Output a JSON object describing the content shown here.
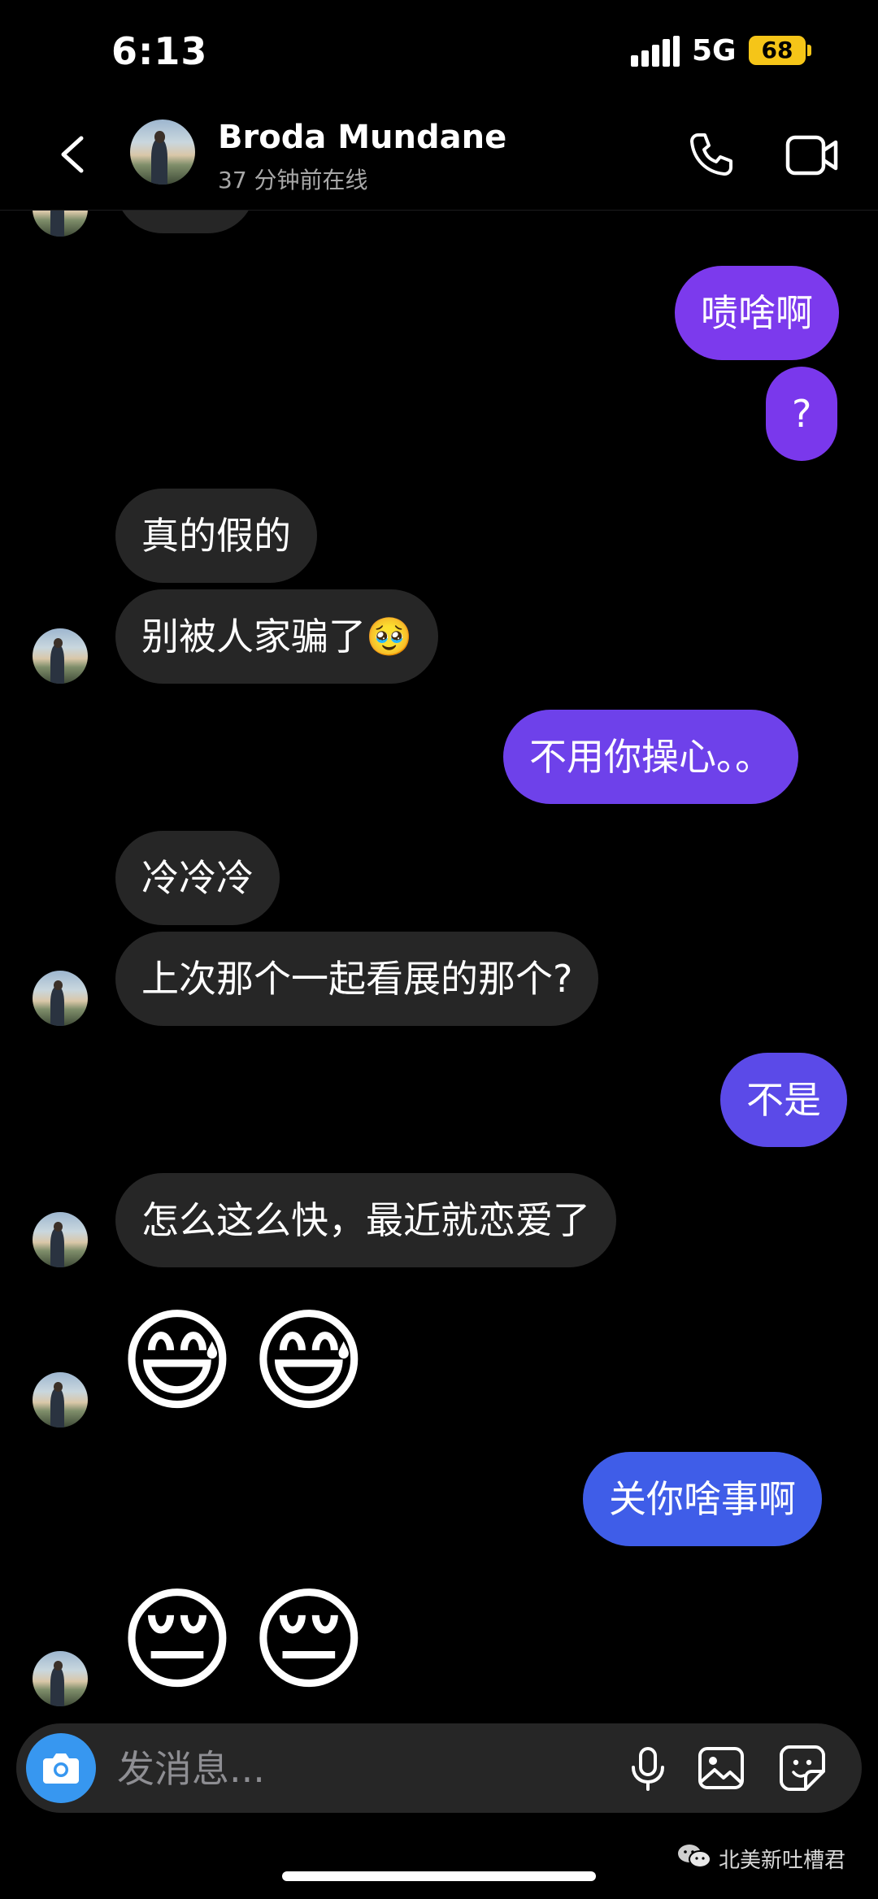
{
  "status_bar": {
    "time": "6:13",
    "network": "5G",
    "battery": "68"
  },
  "header": {
    "contact_name": "Broda Mundane",
    "last_seen": "37 分钟前在线"
  },
  "messages": [
    {
      "dir": "in",
      "text": "..."
    },
    {
      "dir": "out",
      "text": "啧啥啊"
    },
    {
      "dir": "out",
      "text": "?"
    },
    {
      "dir": "in",
      "text": "真的假的"
    },
    {
      "dir": "in",
      "text": "别被人家骗了🥹"
    },
    {
      "dir": "out",
      "text": "不用你操心。。"
    },
    {
      "dir": "in",
      "text": "冷冷冷"
    },
    {
      "dir": "in",
      "text": "上次那个一起看展的那个?"
    },
    {
      "dir": "out",
      "text": "不是"
    },
    {
      "dir": "in",
      "text": "怎么这么快，最近就恋爱了"
    },
    {
      "dir": "in",
      "text": "😅😅"
    },
    {
      "dir": "out",
      "text": "关你啥事啊"
    },
    {
      "dir": "in",
      "text": "😔😔"
    }
  ],
  "composer": {
    "placeholder": "发消息..."
  },
  "watermark": "北美新吐槽君",
  "colors": {
    "outgoing_purple": "#7c3aed",
    "outgoing_blue": "#3f5de8",
    "incoming": "#262626",
    "accent": "#3797f0"
  },
  "icons": [
    "back-icon",
    "call-icon",
    "video-call-icon",
    "camera-icon",
    "mic-icon",
    "gallery-icon",
    "sticker-icon"
  ]
}
